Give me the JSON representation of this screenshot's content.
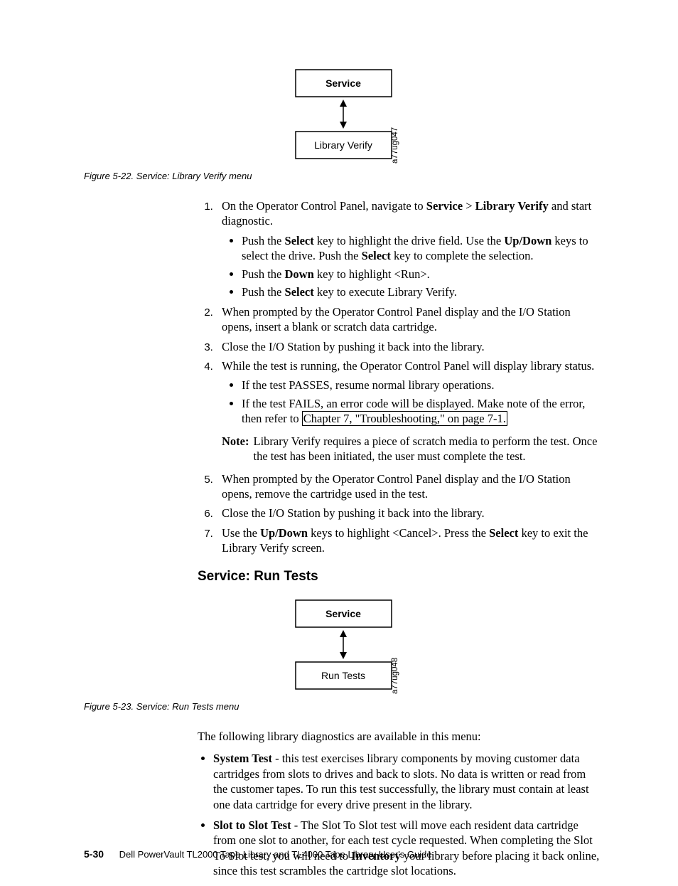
{
  "diagram1": {
    "box_top": "Service",
    "box_bottom": "Library Verify",
    "ref": "a77ug047"
  },
  "fig1_caption": "Figure 5-22. Service: Library Verify menu",
  "steps_a": {
    "s1": {
      "text_pre": "On the Operator Control Panel, navigate to ",
      "b1": "Service",
      "gt": ">",
      "b2": "Library Verify",
      "text_post": " and start diagnostic.",
      "sub1_pre": "Push the ",
      "sub1_b1": "Select",
      "sub1_mid": " key to highlight the drive field. Use the ",
      "sub1_b2": "Up/Down",
      "sub1_mid2": " keys to select the drive. Push the ",
      "sub1_b3": "Select",
      "sub1_post": " key to complete the selection.",
      "sub2_pre": "Push the ",
      "sub2_b": "Down",
      "sub2_post": " key to highlight <Run>.",
      "sub3_pre": "Push the ",
      "sub3_b": "Select",
      "sub3_post": " key to execute Library Verify."
    },
    "s2": "When prompted by the Operator Control Panel display and the I/O Station opens, insert a blank or scratch data cartridge.",
    "s3": "Close the I/O Station by pushing it back into the library.",
    "s4_text": "While the test is running, the Operator Control Panel will display library status.",
    "s4_sub1": "If the test PASSES, resume normal library operations.",
    "s4_sub2_pre": "If the test FAILS, an error code will be displayed. Make note of the error, then refer to ",
    "s4_sub2_link": "Chapter 7, \"Troubleshooting,\" on page 7-1.",
    "note_label": "Note:",
    "note_body": "Library Verify requires a piece of scratch media to perform the test. Once the test has been initiated, the user must complete the test.",
    "s5": "When prompted by the Operator Control Panel display and the I/O Station opens, remove the cartridge used in the test.",
    "s6": "Close the I/O Station by pushing it back into the library.",
    "s7_pre": "Use the ",
    "s7_b1": "Up/Down",
    "s7_mid": " keys to highlight <Cancel>. Press the ",
    "s7_b2": "Select",
    "s7_post": " key to exit the Library Verify screen."
  },
  "heading2": "Service: Run Tests",
  "diagram2": {
    "box_top": "Service",
    "box_bottom": "Run Tests",
    "ref": "a77ug048"
  },
  "fig2_caption": "Figure 5-23. Service: Run Tests menu",
  "para2": "The following library diagnostics are available in this menu:",
  "bullets2": {
    "b1_b": "System Test",
    "b1_text": " - this test exercises library components by moving customer data cartridges from slots to drives and back to slots. No data is written or read from the customer tapes. To run this test successfully, the library must contain at least one data cartridge for every drive present in the library.",
    "b2_b": "Slot to Slot Test",
    "b2_text1": " - The Slot To Slot test will move each resident data cartridge from one slot to another, for each test cycle requested. When completing the Slot To Slot test, you will need to ",
    "b2_bb": "Inventory",
    "b2_text2": " your library before placing it back online, since this test scrambles the cartridge slot locations."
  },
  "footer": {
    "page": "5-30",
    "title": "Dell PowerVault TL2000 Tape Library and TL4000 Tape Library User's Guide"
  }
}
